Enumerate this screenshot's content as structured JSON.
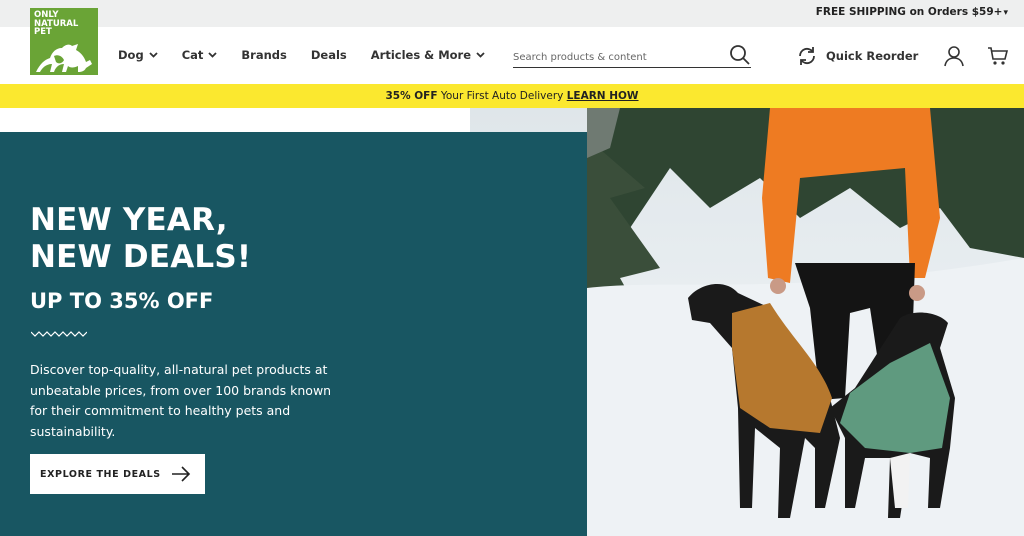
{
  "topbar": {
    "shipping_text": "FREE SHIPPING on Orders $59+",
    "shipping_caret": "▾"
  },
  "logo": {
    "text": "ONLY NATURAL PET",
    "color": "#6aa436"
  },
  "nav": {
    "items": [
      {
        "label": "Dog",
        "has_dropdown": true
      },
      {
        "label": "Cat",
        "has_dropdown": true
      },
      {
        "label": "Brands",
        "has_dropdown": false
      },
      {
        "label": "Deals",
        "has_dropdown": false
      },
      {
        "label": "Articles & More",
        "has_dropdown": true
      }
    ]
  },
  "search": {
    "placeholder": "Search products & content",
    "icon": "search-icon"
  },
  "quick_reorder": {
    "label": "Quick Reorder",
    "icon": "refresh-icon"
  },
  "account": {
    "icon": "user-icon"
  },
  "cart": {
    "icon": "cart-icon"
  },
  "promo": {
    "bold": "35% OFF",
    "text": " Your First Auto Delivery ",
    "link": "LEARN HOW",
    "color": "#fbe82f"
  },
  "hero": {
    "headline_line1": "NEW YEAR,",
    "headline_line2": "NEW DEALS!",
    "subhead": "UP TO 35% OFF",
    "description": "Discover top-quality, all-natural pet products at unbeatable prices, from over 100 brands known for their commitment to healthy pets and sustainability.",
    "cta_label": "EXPLORE THE DEALS",
    "panel_color": "#185662"
  }
}
